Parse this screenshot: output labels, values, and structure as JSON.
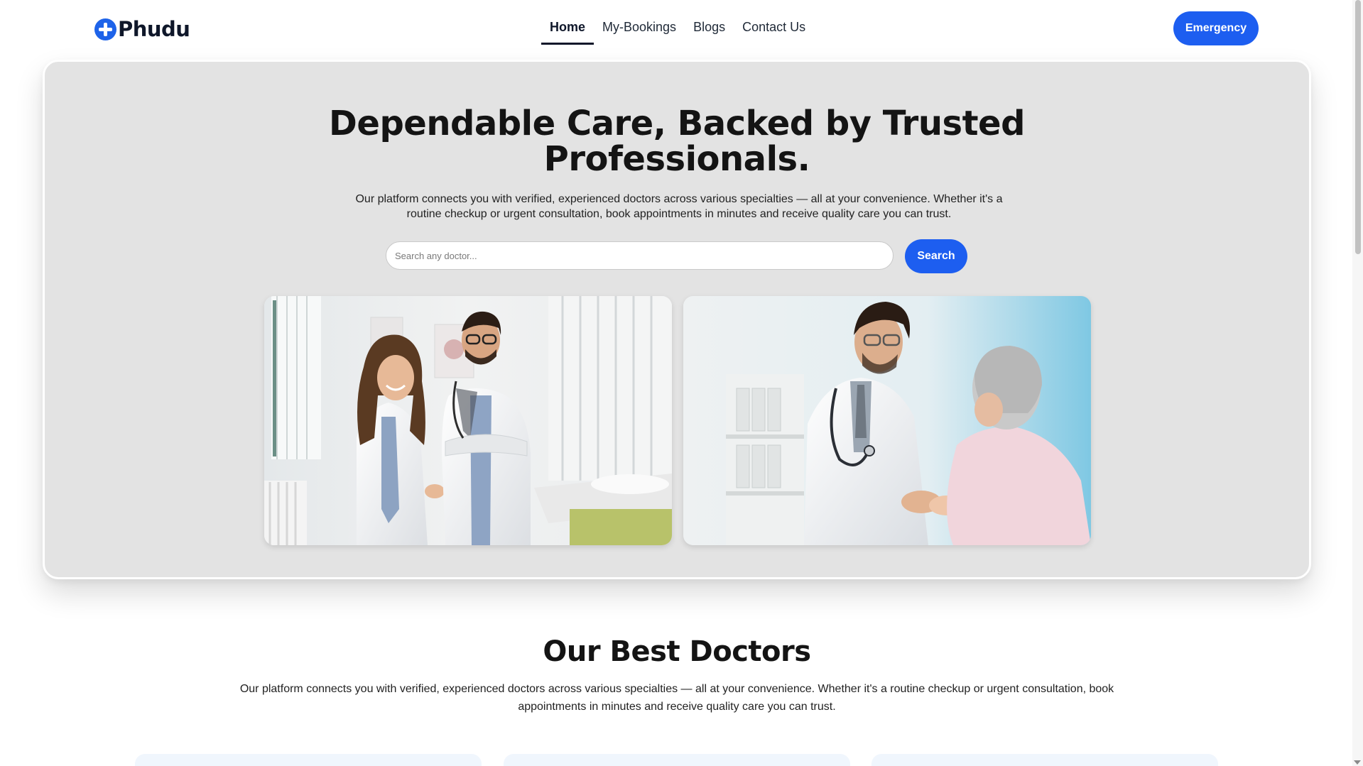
{
  "brand": {
    "name": "Phudu",
    "icon": "medical-cross-icon",
    "accent_color": "#1d5ef0"
  },
  "nav": {
    "items": [
      {
        "label": "Home",
        "active": true
      },
      {
        "label": "My-Bookings",
        "active": false
      },
      {
        "label": "Blogs",
        "active": false
      },
      {
        "label": "Contact Us",
        "active": false
      }
    ],
    "emergency_label": "Emergency"
  },
  "hero": {
    "title_line1": "Dependable Care, Backed by Trusted",
    "title_line2": "Professionals.",
    "description": "Our platform connects you with verified, experienced doctors across various specialties — all at your convenience. Whether it's a routine checkup or urgent consultation, book appointments in minutes and receive quality care you can trust.",
    "search_placeholder": "Search any doctor...",
    "search_value": "",
    "search_button": "Search",
    "images": [
      "two-doctors-smiling-photo",
      "doctor-holding-patient-hands-photo"
    ]
  },
  "best_doctors": {
    "title": "Our Best Doctors",
    "description": "Our platform connects you with verified, experienced doctors across various specialties — all at your convenience. Whether it's a routine checkup or urgent consultation, book appointments in minutes and receive quality care you can trust."
  }
}
